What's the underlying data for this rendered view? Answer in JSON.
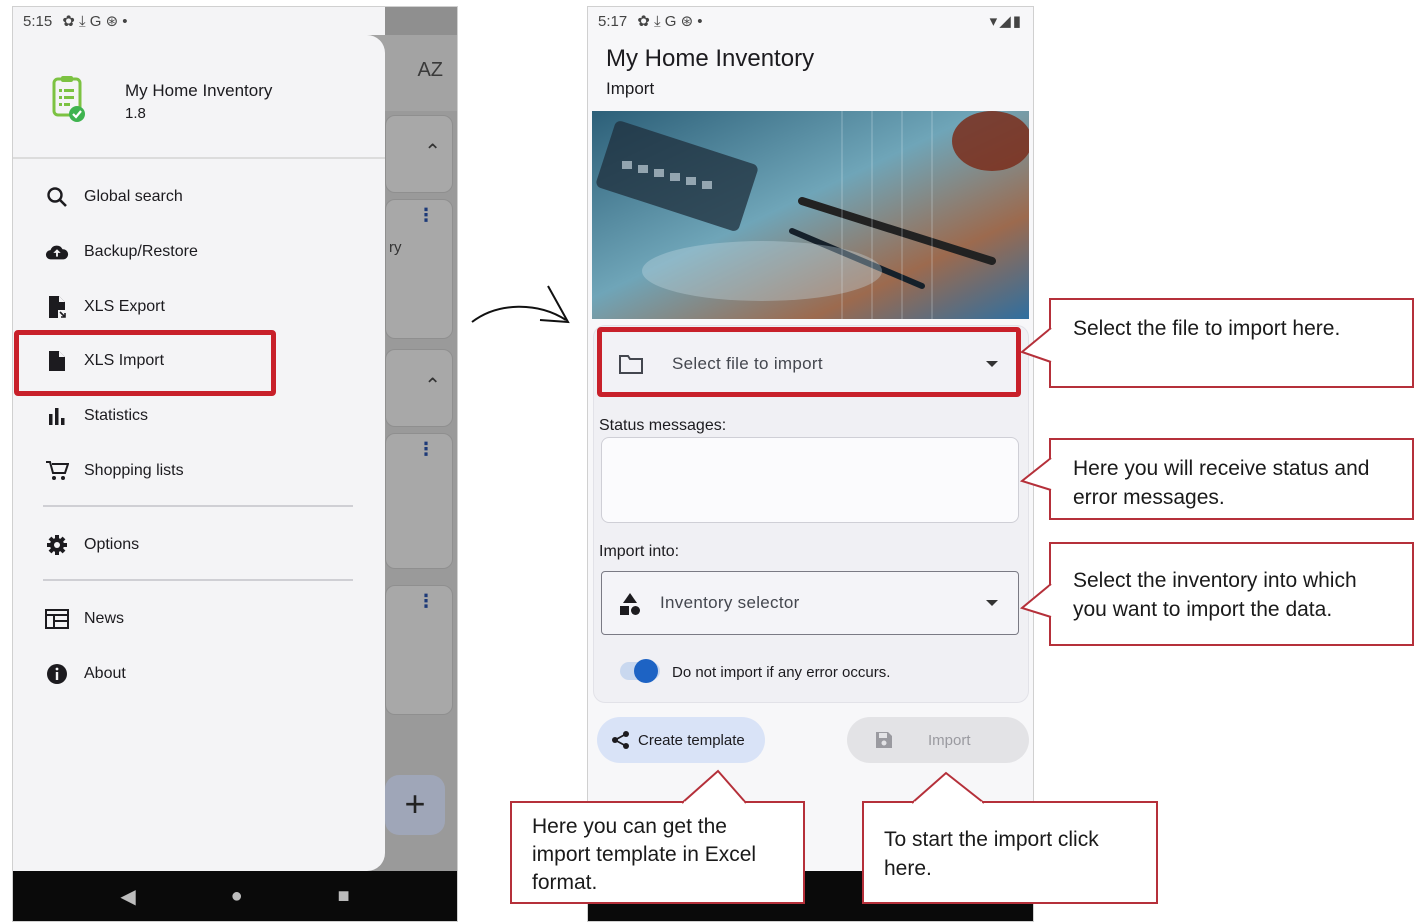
{
  "phone1": {
    "status_time": "5:15",
    "status_icons": "✿ ⤓ G ⊛ •",
    "status_right": "▾◢▮",
    "bg_sort_label": "AZ",
    "bg_partial_text": "ry",
    "app_name": "My Home Inventory",
    "app_version": "1.8",
    "menu": [
      {
        "label": "Global search",
        "icon": "search-icon"
      },
      {
        "label": "Backup/Restore",
        "icon": "cloud-upload-icon"
      },
      {
        "label": "XLS Export",
        "icon": "file-export-icon"
      },
      {
        "label": "XLS Import",
        "icon": "file-icon"
      },
      {
        "label": "Statistics",
        "icon": "bar-chart-icon"
      },
      {
        "label": "Shopping lists",
        "icon": "cart-icon"
      },
      {
        "label": "Options",
        "icon": "gear-icon"
      },
      {
        "label": "News",
        "icon": "news-icon"
      },
      {
        "label": "About",
        "icon": "info-icon"
      }
    ],
    "fab_label": "+"
  },
  "phone2": {
    "status_time": "5:17",
    "status_icons": "✿ ⤓ G ⊛ •",
    "status_right": "▾◢▮",
    "title": "My Home Inventory",
    "subtitle": "Import",
    "select_file_label": "Select file to import",
    "status_messages_label": "Status messages:",
    "import_into_label": "Import into:",
    "inventory_selector_label": "Inventory selector",
    "toggle_label": "Do not import if any error occurs.",
    "toggle_on": true,
    "create_template_label": "Create template",
    "import_label": "Import"
  },
  "callouts": {
    "select_file": "Select the file to import here.",
    "status": "Here you will receive status and error messages.",
    "inventory": "Select the inventory into which you want to import the data.",
    "template": "Here you can get the import template in Excel format.",
    "start_import": "To start the import click here."
  },
  "colors": {
    "highlight": "#c8202a",
    "callout_border": "#b5303a",
    "accent": "#1d63c4",
    "tonal_button": "#d9e3f7"
  }
}
